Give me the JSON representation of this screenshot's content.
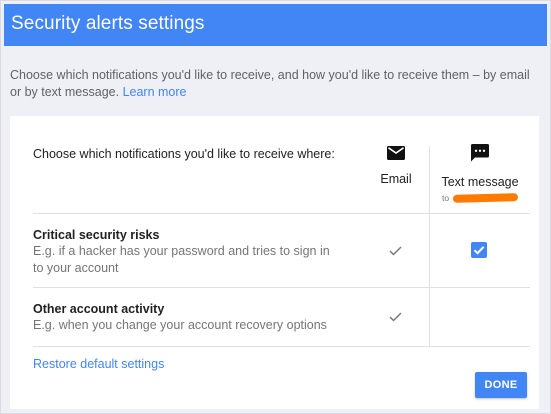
{
  "dialog": {
    "title": "Security alerts settings",
    "intro_text": "Choose which notifications you'd like to receive, and how you'd like to receive them – by email or by text message.",
    "learn_more": "Learn more"
  },
  "table": {
    "header_text": "Choose which notifications you'd like to receive where:",
    "columns": [
      {
        "label": "Email",
        "icon": "email-icon"
      },
      {
        "label": "Text message",
        "icon": "message-icon",
        "recipient_prefix": "to"
      }
    ],
    "rows": [
      {
        "title": "Critical security risks",
        "description": "E.g. if a hacker has your password and tries to sign in to your account",
        "email": true,
        "text_message": true
      },
      {
        "title": "Other account activity",
        "description": "E.g. when you change your account recovery options",
        "email": true,
        "text_message": false
      }
    ]
  },
  "footer": {
    "restore_label": "Restore default settings",
    "done_label": "DONE"
  },
  "colors": {
    "accent": "#4285f4",
    "redaction": "#ff7b00"
  }
}
